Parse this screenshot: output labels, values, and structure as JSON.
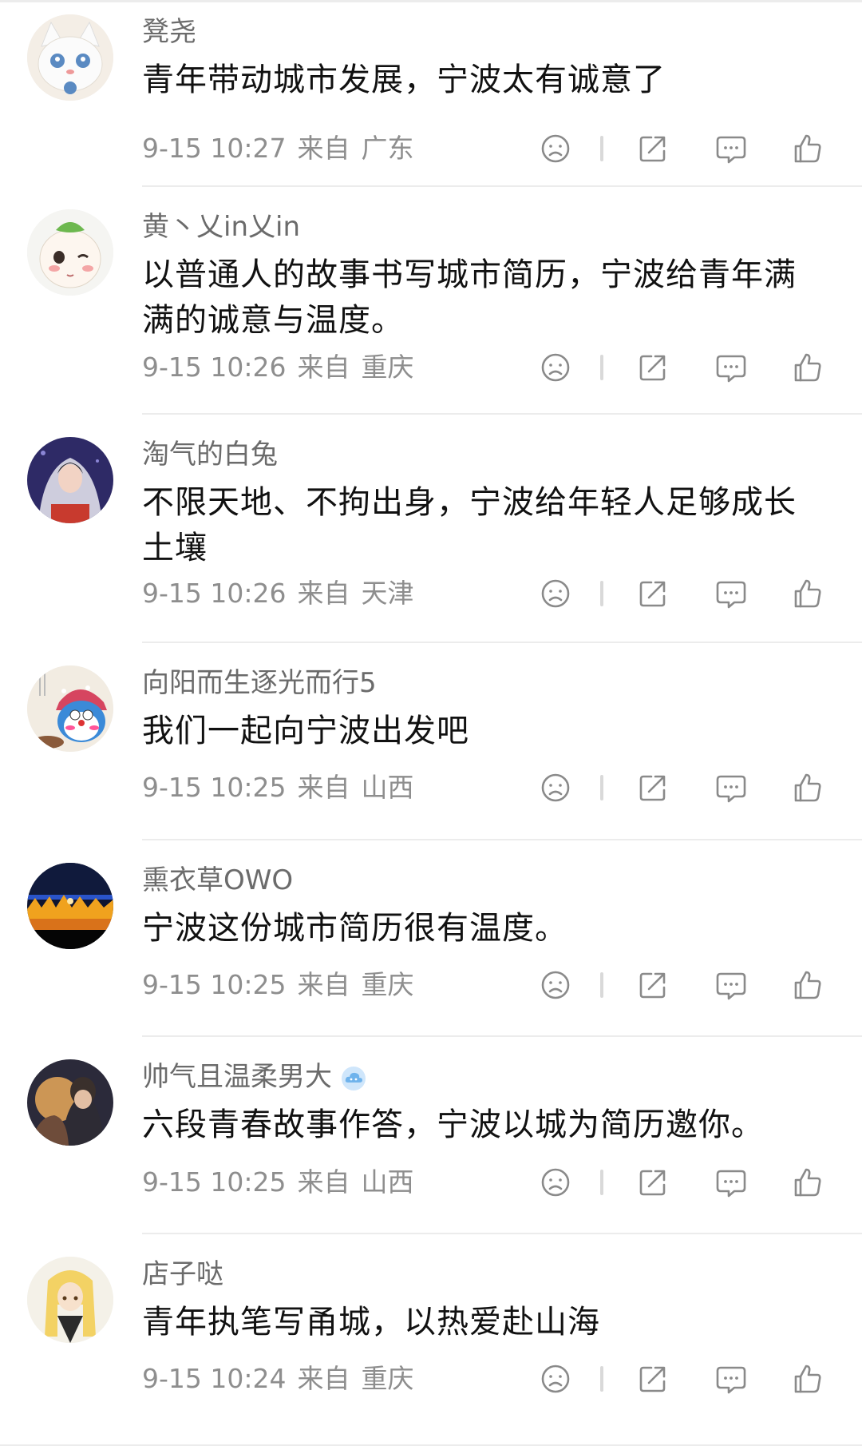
{
  "comments": [
    {
      "username": "凳尧",
      "text": "青年带动城市发展，宁波太有诚意了",
      "date": "9-15 10:27",
      "from": "来自",
      "location": "广东",
      "avatar": "white-cartoon-cat-avatar",
      "avatar_colors": {
        "bg": "#f4eee6",
        "main": "#fbfbfb",
        "accent": "#5a8ac2"
      }
    },
    {
      "username": "黄丶乂in乂in",
      "text": "以普通人的故事书写城市简历，宁波给青年满满的诚意与温度。",
      "date": "9-15 10:26",
      "from": "来自",
      "location": "重庆",
      "avatar": "cartoon-baby-with-leaf-avatar",
      "avatar_colors": {
        "bg": "#f5f5f2",
        "main": "#fdf6ef",
        "accent": "#6db84f"
      }
    },
    {
      "username": "淘气的白兔",
      "text": "不限天地、不拘出身，宁波给年轻人足够成长土壤",
      "date": "9-15 10:26",
      "from": "来自",
      "location": "天津",
      "avatar": "bride-photo-avatar",
      "avatar_colors": {
        "bg": "#2e2a66",
        "main": "#eaeaf2",
        "accent": "#c83a2e"
      }
    },
    {
      "username": "向阳而生逐光而行5",
      "text": "我们一起向宁波出发吧",
      "date": "9-15 10:25",
      "from": "来自",
      "location": "山西",
      "avatar": "doraemon-with-headscarf-avatar",
      "avatar_colors": {
        "bg": "#f2ece2",
        "main": "#3b8ad8",
        "accent": "#d64560"
      }
    },
    {
      "username": "熏衣草OWO",
      "text": "宁波这份城市简历很有温度。",
      "date": "9-15 10:25",
      "from": "来自",
      "location": "重庆",
      "avatar": "night-city-lights-avatar",
      "avatar_colors": {
        "bg": "#0f1530",
        "main": "#f0a21e",
        "accent": "#2a54c9"
      }
    },
    {
      "username": "帅气且温柔男大",
      "badge": "cloud-badge-icon",
      "text": "六段青春故事作答，宁波以城为简历邀你。",
      "date": "9-15 10:25",
      "from": "来自",
      "location": "山西",
      "avatar": "anime-couple-sunset-avatar",
      "avatar_colors": {
        "bg": "#2b2a3a",
        "main": "#e9a95a",
        "accent": "#6e4c3a"
      }
    },
    {
      "username": "店子哒",
      "text": "青年执笔写甬城，以热爱赴山海",
      "date": "9-15 10:24",
      "from": "来自",
      "location": "重庆",
      "avatar": "anime-blonde-character-avatar",
      "avatar_colors": {
        "bg": "#f4f1e8",
        "main": "#f3d264",
        "accent": "#2b2b2b"
      }
    }
  ],
  "icons": {
    "dislike": "sad-face-icon",
    "share": "share-icon",
    "reply": "comment-bubble-icon",
    "like": "thumbs-up-icon"
  },
  "colors": {
    "text": "#111111",
    "username": "#6b6b6b",
    "meta": "#8e8e8e",
    "icon": "#8a8a8a",
    "divider": "#ececec"
  }
}
